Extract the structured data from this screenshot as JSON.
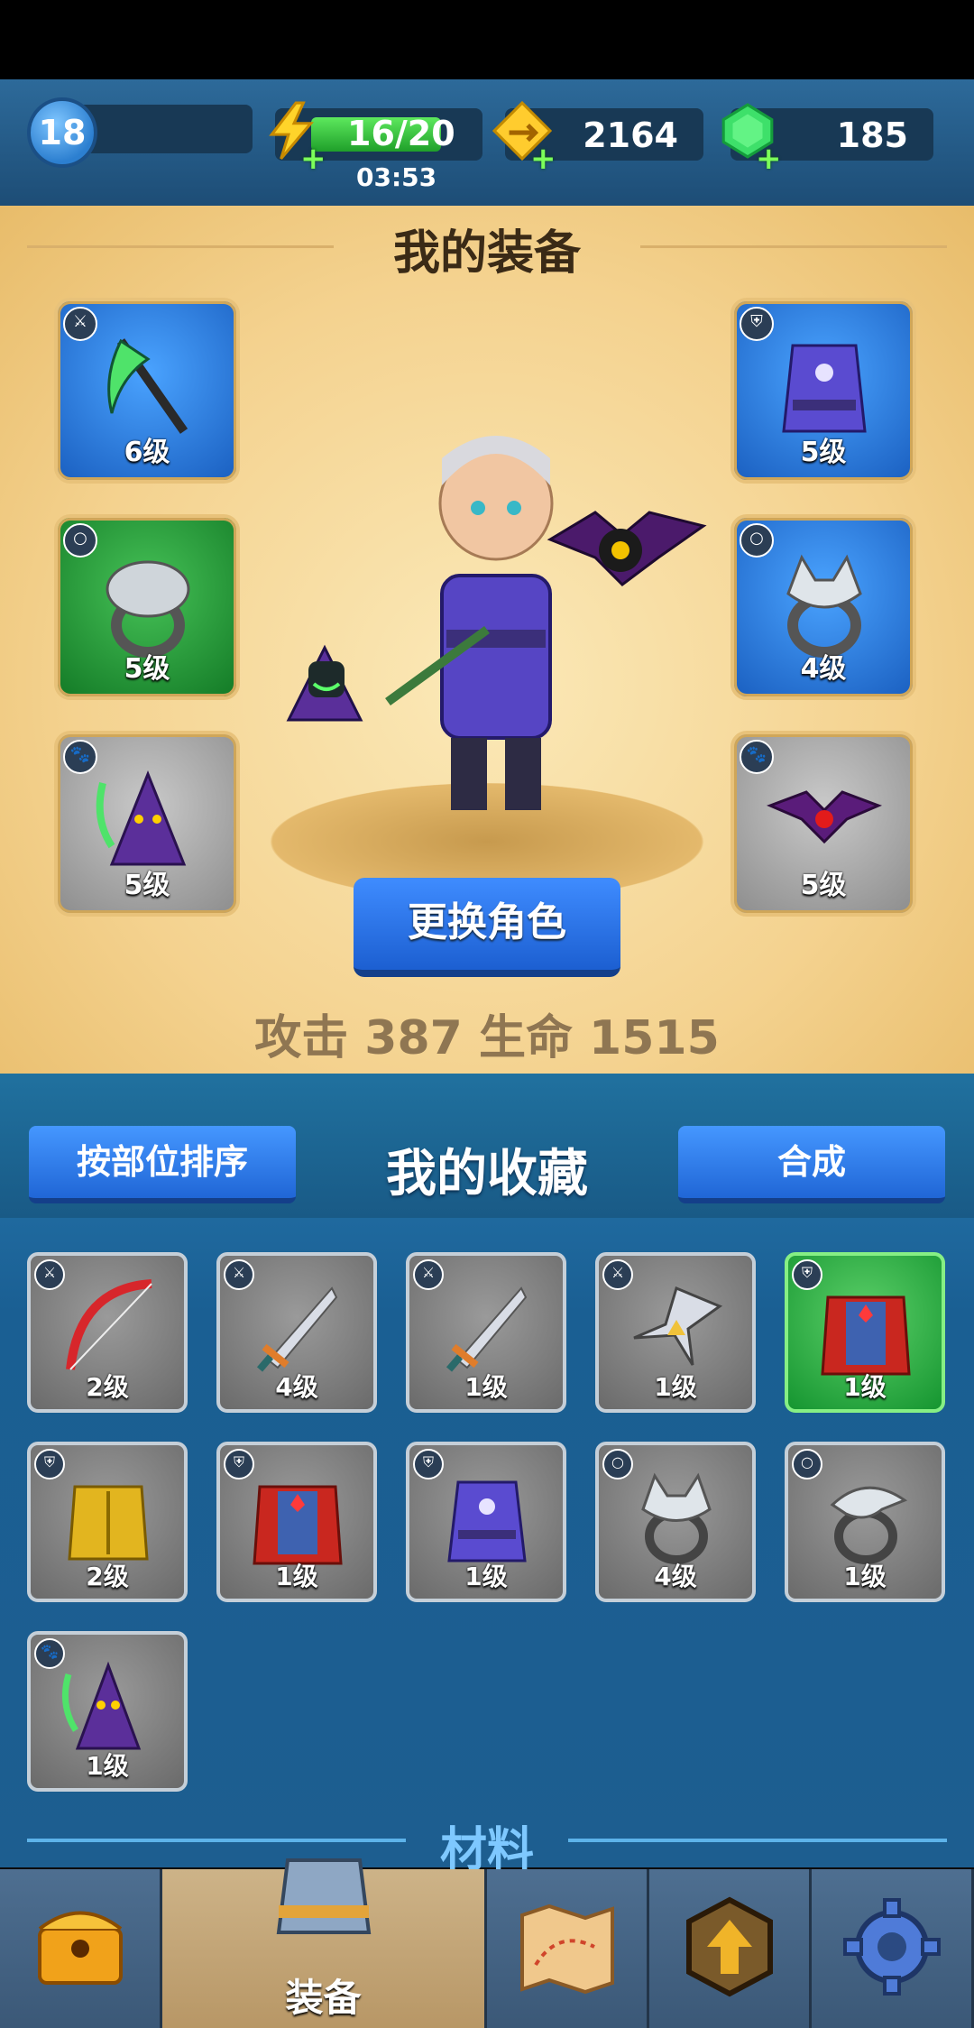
{
  "top_bar": {
    "level": "18",
    "energy": {
      "current_max": "16/20",
      "fill": 0.8,
      "timer": "03:53"
    },
    "gold": "2164",
    "gems": "185"
  },
  "equipment": {
    "title": "我的装备",
    "slots": [
      {
        "name": "scythe",
        "level": "6级",
        "rarity": "blue",
        "type_icon": "weapon-icon"
      },
      {
        "name": "robe",
        "level": "5级",
        "rarity": "blue",
        "type_icon": "armor-icon"
      },
      {
        "name": "serpent-ring",
        "level": "5级",
        "rarity": "green",
        "type_icon": "ring-icon"
      },
      {
        "name": "wolf-ring",
        "level": "4级",
        "rarity": "blue",
        "type_icon": "ring-icon"
      },
      {
        "name": "reaper-pet",
        "level": "5级",
        "rarity": "gray",
        "type_icon": "pet-paw-icon"
      },
      {
        "name": "bat-pet",
        "level": "5级",
        "rarity": "gray",
        "type_icon": "pet-paw-icon"
      }
    ],
    "change_character": "更换角色",
    "stats": "攻击 387  生命 1515"
  },
  "collection": {
    "sort_button": "按部位排序",
    "title": "我的收藏",
    "merge_button": "合成",
    "items": [
      {
        "name": "bow",
        "level": "2级",
        "rarity": "gray",
        "type_icon": "weapon-icon"
      },
      {
        "name": "sword",
        "level": "4级",
        "rarity": "gray",
        "type_icon": "weapon-icon"
      },
      {
        "name": "sword",
        "level": "1级",
        "rarity": "gray",
        "type_icon": "weapon-icon"
      },
      {
        "name": "shuriken",
        "level": "1级",
        "rarity": "gray",
        "type_icon": "weapon-icon"
      },
      {
        "name": "caped-armor",
        "level": "1级",
        "rarity": "green",
        "type_icon": "armor-icon"
      },
      {
        "name": "golden-armor",
        "level": "2级",
        "rarity": "gray",
        "type_icon": "armor-icon"
      },
      {
        "name": "caped-armor",
        "level": "1级",
        "rarity": "gray",
        "type_icon": "armor-icon"
      },
      {
        "name": "robe",
        "level": "1级",
        "rarity": "gray",
        "type_icon": "armor-icon"
      },
      {
        "name": "wolf-ring",
        "level": "4级",
        "rarity": "gray",
        "type_icon": "ring-icon"
      },
      {
        "name": "eagle-ring",
        "level": "1级",
        "rarity": "gray",
        "type_icon": "ring-icon"
      },
      {
        "name": "reaper-pet",
        "level": "1级",
        "rarity": "gray",
        "type_icon": "pet-paw-icon"
      }
    ],
    "materials_label": "材料"
  },
  "nav": {
    "items": [
      {
        "name": "shop-chest-icon"
      },
      {
        "name": "equipment-icon",
        "label": "装备",
        "active": true
      },
      {
        "name": "map-icon"
      },
      {
        "name": "upgrade-icon"
      },
      {
        "name": "settings-gear-icon"
      }
    ]
  },
  "colors": {
    "accent_blue": "#2f7af0",
    "gold_bg": "#f4d28f",
    "collection_bg": "#1d5e90"
  }
}
